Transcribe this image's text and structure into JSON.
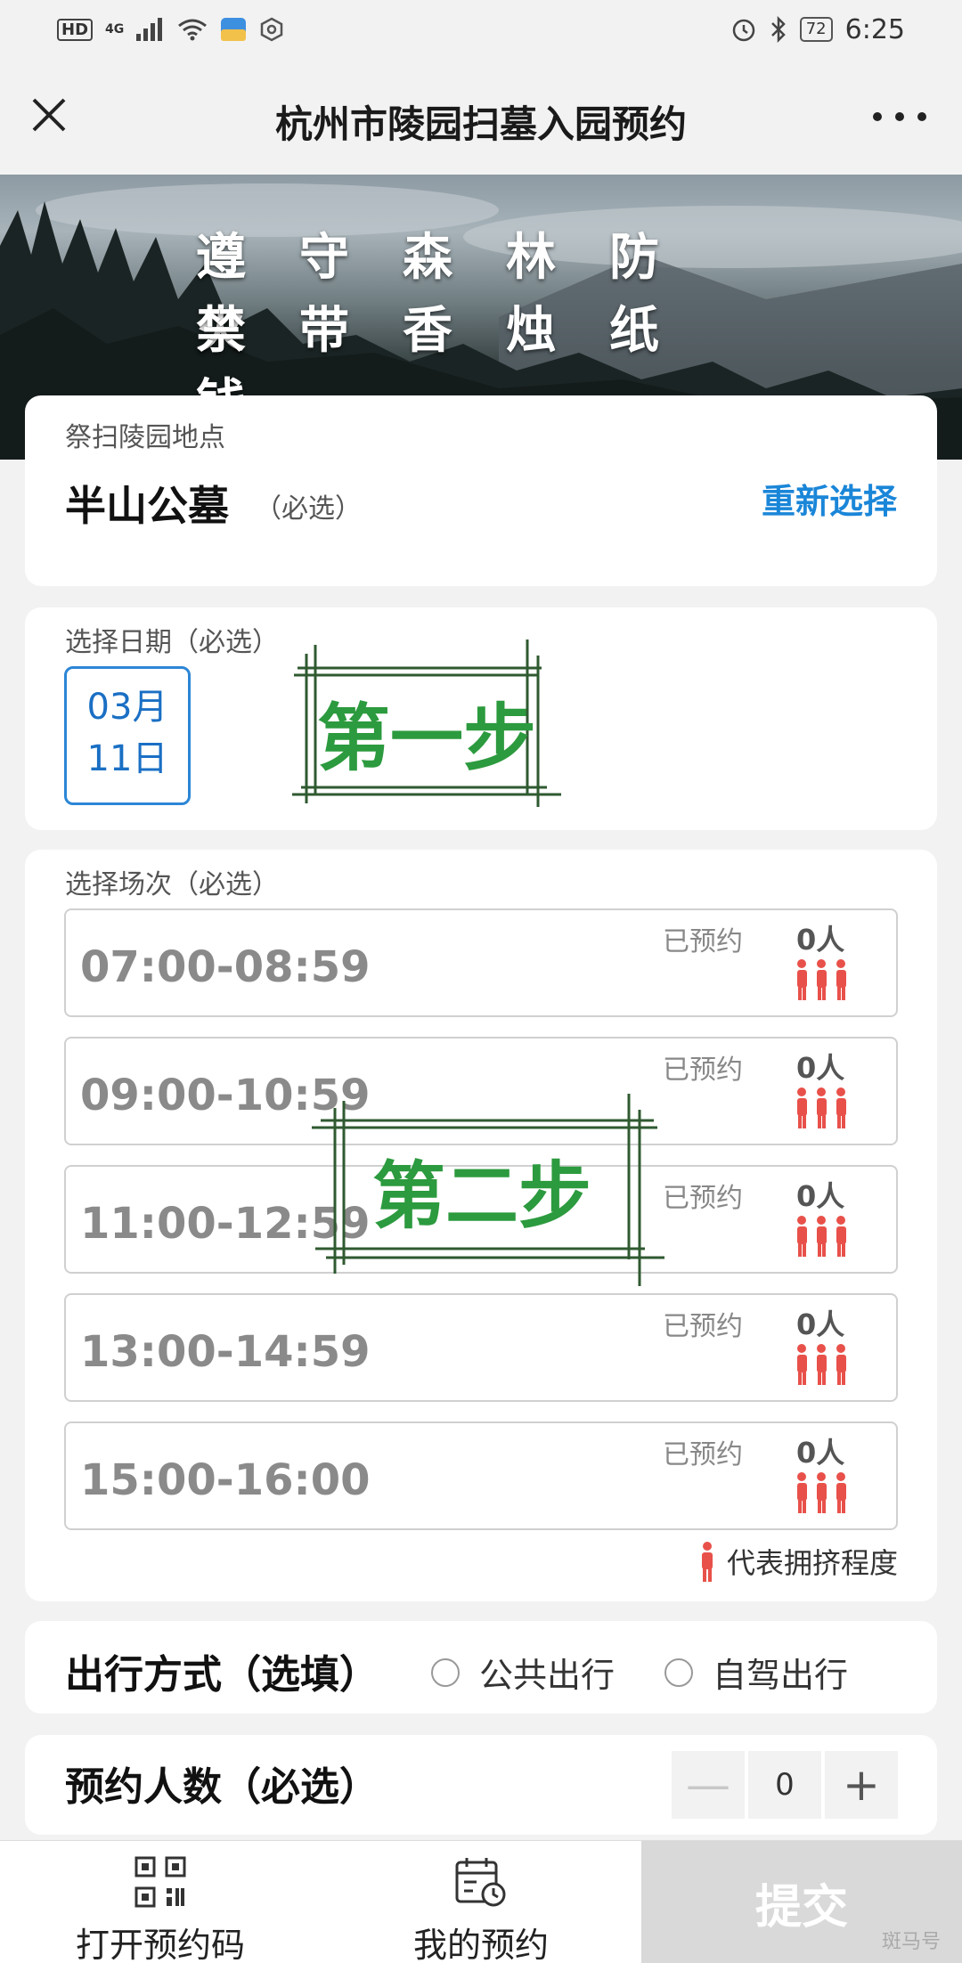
{
  "status_bar": {
    "hd": "HD",
    "network": "4G",
    "battery": "72",
    "time": "6:25"
  },
  "header": {
    "title": "杭州市陵园扫墓入园预约"
  },
  "banner": {
    "line1": "遵守森林防火",
    "line2": "禁带香烛纸钱"
  },
  "location": {
    "label": "祭扫陵园地点",
    "name": "半山公墓",
    "required": "（必选）",
    "reselect": "重新选择"
  },
  "date": {
    "label": "选择日期（必选）",
    "month": "03月",
    "day": "11日",
    "stamp": "第一步"
  },
  "sessions": {
    "label": "选择场次（必选）",
    "stamp": "第二步",
    "slots": [
      {
        "time": "07:00-08:59",
        "booked_label": "已预约",
        "count": "0人"
      },
      {
        "time": "09:00-10:59",
        "booked_label": "已预约",
        "count": "0人"
      },
      {
        "time": "11:00-12:59",
        "booked_label": "已预约",
        "count": "0人"
      },
      {
        "time": "13:00-14:59",
        "booked_label": "已预约",
        "count": "0人"
      },
      {
        "time": "15:00-16:00",
        "booked_label": "已预约",
        "count": "0人"
      }
    ],
    "legend": "代表拥挤程度"
  },
  "travel": {
    "title": "出行方式（选填）",
    "option1": "公共出行",
    "option2": "自驾出行"
  },
  "people": {
    "title": "预约人数（必选）",
    "value": "0",
    "minus": "—",
    "plus": "+"
  },
  "bottom_nav": {
    "open_code": "打开预约码",
    "my_booking": "我的预约",
    "submit": "提交"
  },
  "watermark": "斑马号",
  "colors": {
    "accent_blue": "#1a86d8",
    "stamp_green": "#2c9a3e",
    "crowd_red": "#e8514a"
  }
}
